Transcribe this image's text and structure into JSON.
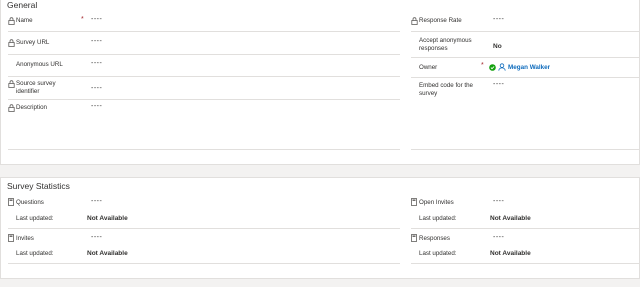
{
  "general": {
    "title": "General",
    "left_fields": [
      {
        "label": "Name",
        "value": "----",
        "required_mark": "*"
      },
      {
        "label": "Survey URL",
        "value": "----"
      },
      {
        "label": "Anonymous URL",
        "value": "----"
      },
      {
        "label": "Source survey identifier",
        "value": "----"
      },
      {
        "label": "Description",
        "value": "----"
      }
    ],
    "right_fields": [
      {
        "label": "Response Rate",
        "value": "----"
      },
      {
        "label": "Accept anonymous responses",
        "value": "No"
      },
      {
        "label": "Owner",
        "value": "Megan Walker",
        "required_mark": "*"
      },
      {
        "label": "Embed code for the survey",
        "value": "----"
      }
    ]
  },
  "stats": {
    "title": "Survey Statistics",
    "last_updated_label": "Last updated:",
    "items": [
      {
        "label": "Questions",
        "value": "----",
        "updated": "Not Available"
      },
      {
        "label": "Invites",
        "value": "----",
        "updated": "Not Available"
      },
      {
        "label": "Open Invites",
        "value": "----",
        "updated": "Not Available"
      },
      {
        "label": "Responses",
        "value": "----",
        "updated": "Not Available"
      }
    ]
  },
  "colors": {
    "accent": "#0f6cbd",
    "required": "#a4262c",
    "status_green": "#13a10e"
  }
}
